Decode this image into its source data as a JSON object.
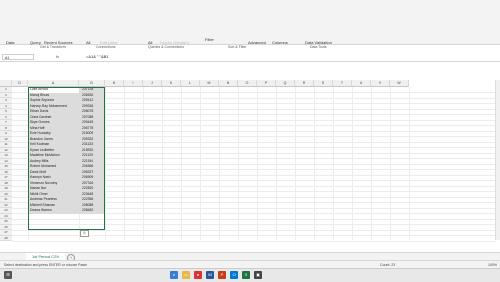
{
  "ribbon": {
    "items": [
      "Data",
      "Query",
      "Recent Sources",
      "All",
      "Edit Links",
      "All",
      "Properties",
      "Stocks (English)",
      "Filter",
      "Advanced",
      "Columns",
      "Data Validation"
    ],
    "groups": [
      "Get & Transform",
      "Connections",
      "Queries & Connections",
      "Sort & Filter",
      "Data Tools"
    ]
  },
  "formula": {
    "namebox": "A1",
    "fx_symbol": "fx",
    "value": "=A1& \" \"&B1"
  },
  "columns": [
    "D",
    "A",
    "B",
    "H",
    "I",
    "J",
    "K",
    "L",
    "M",
    "N",
    "O",
    "P",
    "Q",
    "R",
    "S",
    "T",
    "U",
    "V",
    "W"
  ],
  "rows": [
    {
      "n": "1",
      "name": "Luke Arnold",
      "id": "237135"
    },
    {
      "n": "2",
      "name": "Manoj Bhras",
      "id": "206530"
    },
    {
      "n": "3",
      "name": "Sophie Bryonne",
      "id": "209412"
    },
    {
      "n": "4",
      "name": "Harvey-Ray Mohammed",
      "id": "209336"
    },
    {
      "n": "5",
      "name": "Ethan Davis",
      "id": "208078"
    },
    {
      "n": "6",
      "name": "Clara Gardner",
      "id": "207088"
    },
    {
      "n": "7",
      "name": "Skye Gomes",
      "id": "209445"
    },
    {
      "n": "8",
      "name": "Mina Hoff",
      "id": "206778"
    },
    {
      "n": "9",
      "name": "Evie Huckaby",
      "id": "215009"
    },
    {
      "n": "10",
      "name": "Brandon Jones",
      "id": "209332"
    },
    {
      "n": "11",
      "name": "Keil Kodman",
      "id": "231133"
    },
    {
      "n": "12",
      "name": "Kyran Ledbetter",
      "id": "218932"
    },
    {
      "n": "13",
      "name": "Madeline McMahon",
      "id": "221129"
    },
    {
      "n": "14",
      "name": "Audrey Mills",
      "id": "221154"
    },
    {
      "n": "15",
      "name": "Robert Mohamed",
      "id": "206366"
    },
    {
      "n": "16",
      "name": "Davis Mott",
      "id": "208337"
    },
    {
      "n": "17",
      "name": "Kamryn Nash",
      "id": "206909"
    },
    {
      "n": "18",
      "name": "Vincenzo Novotny",
      "id": "207316"
    },
    {
      "n": "19",
      "name": "Nanan Nur",
      "id": "222820"
    },
    {
      "n": "20",
      "name": "Nikhil Omer",
      "id": "223648"
    },
    {
      "n": "21",
      "name": "Andreas Pearless",
      "id": "222356"
    },
    {
      "n": "22",
      "name": "Mitchell Shaman",
      "id": "208088"
    },
    {
      "n": "23",
      "name": "Deana Warren",
      "id": "208482"
    },
    {
      "n": "24",
      "name": "",
      "id": ""
    },
    {
      "n": "25",
      "name": "",
      "id": ""
    },
    {
      "n": "26",
      "name": "",
      "id": ""
    },
    {
      "n": "27",
      "name": "",
      "id": ""
    },
    {
      "n": "28",
      "name": "",
      "id": ""
    }
  ],
  "sheet_tab": "1st Period CSV",
  "status": {
    "left": "Select destination and press ENTER or choose Paste",
    "count": "Count: 23",
    "zoom": "100%"
  },
  "colors": {
    "accent": "#217346"
  }
}
